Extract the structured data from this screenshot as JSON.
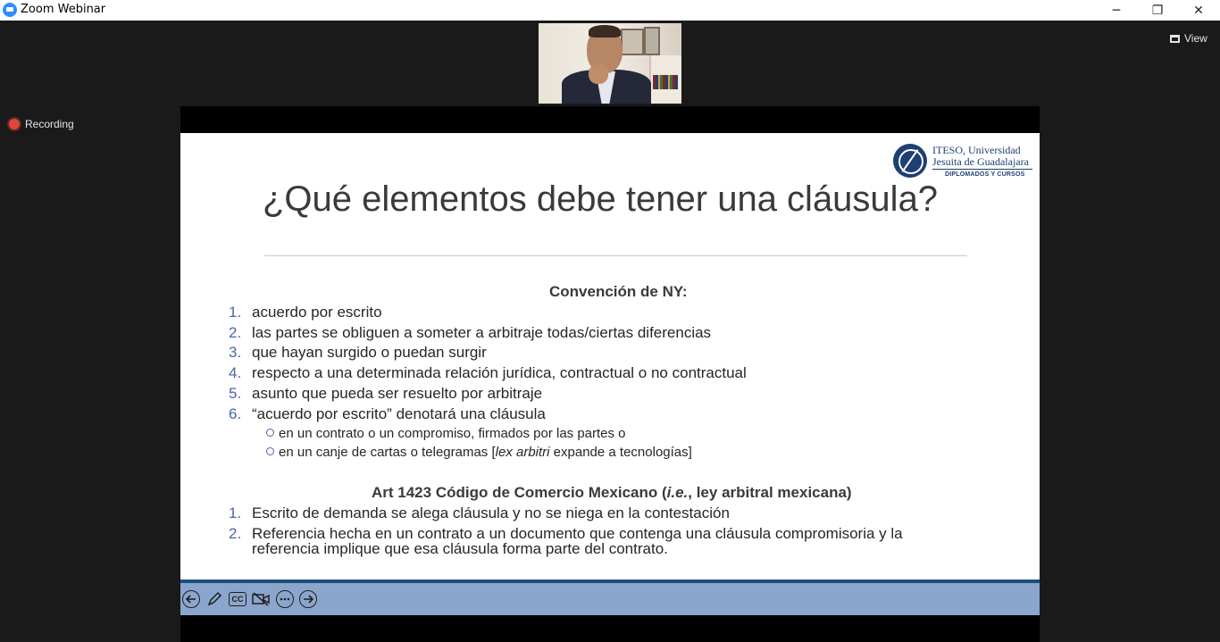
{
  "window": {
    "title": "Zoom Webinar",
    "minimize_glyph": "─",
    "maximize_glyph": "❐",
    "close_glyph": "✕"
  },
  "zoom": {
    "view_label": "View",
    "recording_label": "Recording"
  },
  "slide": {
    "title": "¿Qué elementos debe tener una cláusula?",
    "logo": {
      "line1": "ITESO, Universidad",
      "line2": "Jesuita de Guadalajara",
      "sub": "DIPLOMADOS Y CURSOS"
    },
    "ny_heading": "Convención de NY:",
    "ny_items": [
      {
        "num": "1.",
        "text": "acuerdo por escrito"
      },
      {
        "num": "2.",
        "text": "las partes se obliguen a someter a arbitraje todas/ciertas diferencias"
      },
      {
        "num": "3.",
        "text": "que hayan surgido o puedan surgir"
      },
      {
        "num": "4.",
        "text": "respecto a una determinada relación jurídica, contractual o no contractual"
      },
      {
        "num": "5.",
        "text": "asunto que pueda ser resuelto por arbitraje"
      },
      {
        "num": "6.",
        "text": "“acuerdo por escrito” denotará una cláusula"
      }
    ],
    "sub_items": [
      {
        "text": "en un contrato o un compromiso, firmados por las partes o"
      },
      {
        "text_before": "en un canje de cartas o telegramas [",
        "text_italic": "lex arbitri",
        "text_after": " expande a tecnologías]"
      }
    ],
    "art_heading": {
      "before": "Art 1423 Código de Comercio Mexicano (",
      "italic": "i.e.",
      "after": ", ley arbitral mexicana)"
    },
    "art_items": [
      {
        "num": "1.",
        "text": "Escrito de demanda se alega cláusula y no se niega en la contestación"
      },
      {
        "num": "2.",
        "text": "Referencia hecha en un contrato a un documento que contenga una cláusula compromisoria y la referencia implique que esa cláusula forma parte del contrato."
      }
    ]
  },
  "slideshow_toolbar": {
    "icons": [
      "previous-icon",
      "pen-icon",
      "captions-icon",
      "camera-icon",
      "more-icon",
      "next-icon"
    ],
    "cc_label": "CC"
  },
  "colors": {
    "zoom_background": "#1a1a1a",
    "list_number_blue": "#4a67a8",
    "toolbar_blue": "#8aa6cc",
    "recording_red": "#e0453a"
  }
}
